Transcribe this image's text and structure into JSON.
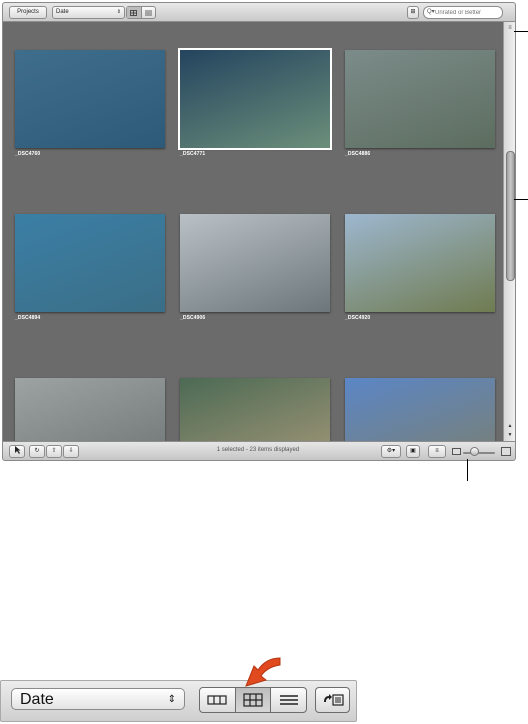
{
  "toolbar": {
    "projects_label": "Projects",
    "sort_value": "Date",
    "sort_arrows": "⇕",
    "filter_glyph": "⊞",
    "search_placeholder": "Unrated or Better",
    "search_glyph": "Q▾"
  },
  "photos": [
    {
      "name": "_DSC4760",
      "colors": [
        "#3f6e8c",
        "#2d5a78"
      ],
      "selected": false
    },
    {
      "name": "_DSC4771",
      "colors": [
        "#24445f",
        "#6b8f7a"
      ],
      "selected": true
    },
    {
      "name": "_DSC4886",
      "colors": [
        "#7b8c8a",
        "#5c6d5f"
      ],
      "selected": false
    },
    {
      "name": "_DSC4894",
      "colors": [
        "#3b7fa6",
        "#3b6e86"
      ],
      "selected": false
    },
    {
      "name": "_DSC4906",
      "colors": [
        "#b9c1c6",
        "#6d777b"
      ],
      "selected": false
    },
    {
      "name": "_DSC4920",
      "colors": [
        "#9db7cf",
        "#6f7b50"
      ],
      "selected": false
    },
    {
      "name": "",
      "colors": [
        "#9da3a3",
        "#6d7373"
      ],
      "selected": false
    },
    {
      "name": "",
      "colors": [
        "#4c6a54",
        "#a89a7a"
      ],
      "selected": false
    },
    {
      "name": "",
      "colors": [
        "#5b86c6",
        "#7c7f6c"
      ],
      "selected": false
    }
  ],
  "status": {
    "text": "1 selected - 23 items displayed"
  },
  "detail": {
    "sort_value": "Date",
    "sort_arrows": "⇕"
  }
}
